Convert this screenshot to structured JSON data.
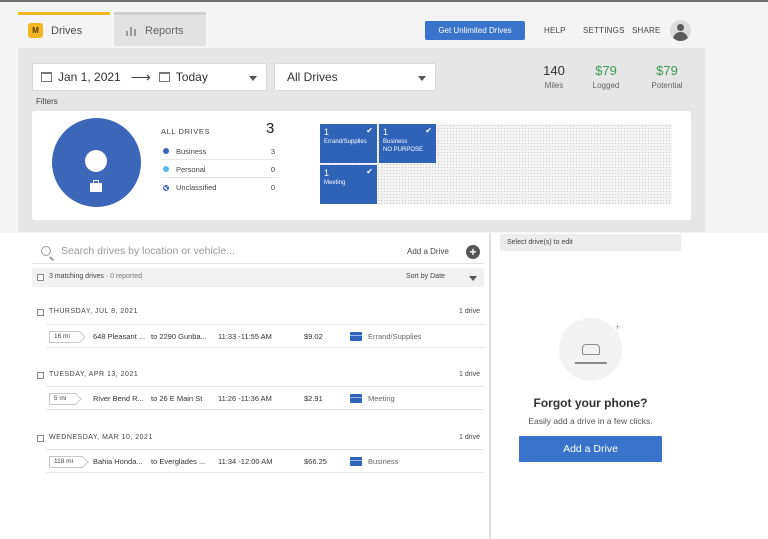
{
  "tabs": [
    {
      "label": "Drives",
      "active": true,
      "icon": "mileiq-logo-icon"
    },
    {
      "label": "Reports",
      "active": false,
      "icon": "bar-chart-icon"
    }
  ],
  "logo_text": "M",
  "header": {
    "cta_label": "Get Unlimited Drives",
    "links": [
      "HELP",
      "SETTINGS",
      "SHARE"
    ],
    "avatar_icon": "user-avatar-icon"
  },
  "filters": {
    "date_from": "Jan 1, 2021",
    "date_to": "Today",
    "drive_filter": "All Drives",
    "label": "Filters"
  },
  "stats": [
    {
      "value": "140",
      "label": "Miles"
    },
    {
      "value": "$79",
      "label": "Logged"
    },
    {
      "value": "$79",
      "label": "Potential"
    }
  ],
  "summary": {
    "title": "ALL DRIVES",
    "total": "3",
    "categories": [
      {
        "label": "Business",
        "count": "3",
        "color": "#3c66b8"
      },
      {
        "label": "Personal",
        "count": "0",
        "color": "#5bb6e8"
      },
      {
        "label": "Unclassified",
        "count": "0",
        "color": "#3c66b8"
      }
    ]
  },
  "tiles": [
    {
      "count": "1",
      "label": "Errand/Supplies",
      "sub": ""
    },
    {
      "count": "1",
      "label": "Business",
      "sub": "NO PURPOSE"
    },
    {
      "count": "1",
      "label": "Meeting",
      "sub": ""
    }
  ],
  "list": {
    "search_placeholder": "Search drives by location or vehicle...",
    "add_label": "Add a Drive",
    "match_text": "3 matching drives",
    "reported_text": "· 0 reported",
    "sort_label": "Sort by Date"
  },
  "days": [
    {
      "date": "THURSDAY, JUL 8, 2021",
      "count": "1 drive",
      "drive": {
        "miles": "16 mi",
        "from": "648 Pleasant ...",
        "to": "to 2290 Gunba...",
        "time": "11:33 -11:55 AM",
        "amount": "$9.02",
        "purpose": "Errand/Supplies"
      }
    },
    {
      "date": "TUESDAY, APR 13, 2021",
      "count": "1 drive",
      "drive": {
        "miles": "5 mi",
        "from": "River Bend R...",
        "to": "to 26 E Main St",
        "time": "11:26 -11:36 AM",
        "amount": "$2.91",
        "purpose": "Meeting"
      }
    },
    {
      "date": "WEDNESDAY, MAR 10, 2021",
      "count": "1 drive",
      "drive": {
        "miles": "118 mi",
        "from": "Bahia Honda...",
        "to": "to Everglades ...",
        "time": "11:34 -12:00 AM",
        "amount": "$66.25",
        "purpose": "Business"
      }
    }
  ],
  "side": {
    "select_label": "Select drive(s) to edit",
    "forgot_title": "Forgot your phone?",
    "forgot_sub": "Easily add a drive in a few clicks.",
    "add_button": "Add a Drive"
  },
  "colors": {
    "brand_yellow": "#f2b620",
    "accent_blue": "#3a73cc",
    "money_green": "#3f9a52"
  }
}
